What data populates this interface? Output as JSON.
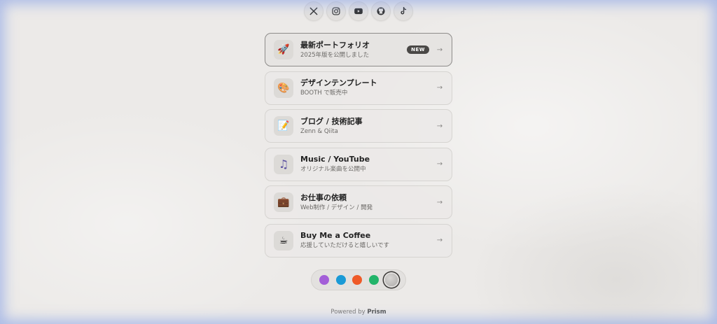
{
  "social": [
    {
      "name": "x-icon"
    },
    {
      "name": "instagram-icon"
    },
    {
      "name": "youtube-icon"
    },
    {
      "name": "github-icon"
    },
    {
      "name": "tiktok-icon"
    }
  ],
  "links": [
    {
      "title": "最新ポートフォリオ",
      "subtitle": "2025年版を公開しました",
      "icon": "rocket-icon",
      "glyph": "🚀",
      "badge": "NEW"
    },
    {
      "title": "デザインテンプレート",
      "subtitle": "BOOTH で販売中",
      "icon": "palette-icon",
      "glyph": "🎨"
    },
    {
      "title": "ブログ / 技術記事",
      "subtitle": "Zenn & Qiita",
      "icon": "pencil-icon",
      "glyph": "📝"
    },
    {
      "title": "Music / YouTube",
      "subtitle": "オリジナル楽曲を公開中",
      "icon": "music-note-icon",
      "glyph": "♫"
    },
    {
      "title": "お仕事の依頼",
      "subtitle": "Web制作 / デザイン / 開発",
      "icon": "briefcase-icon",
      "glyph": "💼"
    },
    {
      "title": "Buy Me a Coffee",
      "subtitle": "応援していただけると嬉しいです",
      "icon": "coffee-icon",
      "glyph": "☕"
    }
  ],
  "themes": [
    {
      "color": "#a35fd8"
    },
    {
      "color": "#1a9ad6"
    },
    {
      "color": "#ef5a28"
    },
    {
      "color": "#22b46a"
    },
    {
      "color": "#c4c2c0",
      "selected": true
    }
  ],
  "footer": {
    "prefix": "Powered by",
    "brand": "Prism"
  }
}
